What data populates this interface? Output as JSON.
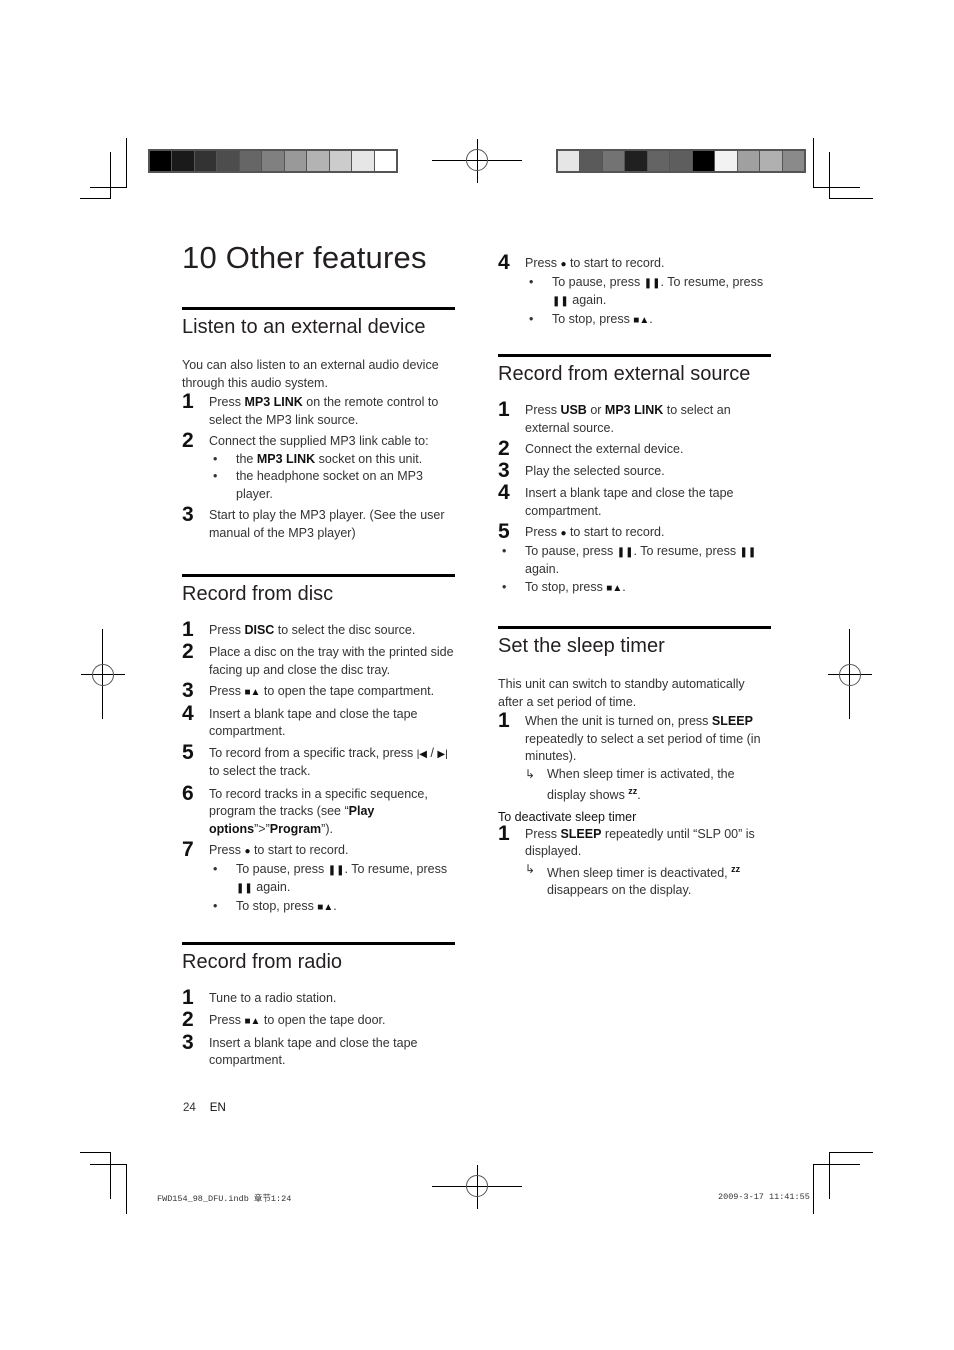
{
  "chapter": {
    "number": "10",
    "title": "10 Other features"
  },
  "color_bars": {
    "left": [
      "#000000",
      "#1a1a1a",
      "#333333",
      "#4d4d4d",
      "#666666",
      "#808080",
      "#999999",
      "#b3b3b3",
      "#cccccc",
      "#e6e6e6",
      "#ffffff"
    ],
    "right": [
      "#e6e6e6",
      "#5a5a5a",
      "#737373",
      "#202020",
      "#646464",
      "#5e5e5e",
      "#000000",
      "#f2f2f2",
      "#a0a0a0",
      "#b0b0b0",
      "#8a8a8a"
    ]
  },
  "sections": {
    "listen_external": {
      "title": "Listen to an external device",
      "intro": "You can also listen to an external audio device through this audio system.",
      "steps": [
        {
          "num": "1",
          "pre": "Press ",
          "bold": "MP3 LINK",
          "post": " on the remote control to select the MP3 link source."
        },
        {
          "num": "2",
          "text": "Connect the supplied MP3 link cable to:",
          "bullets": [
            {
              "pre": "the ",
              "bold": "MP3 LINK",
              "post": " socket on this unit."
            },
            {
              "text": "the headphone socket on an MP3 player."
            }
          ]
        },
        {
          "num": "3",
          "text": "Start to play the MP3 player. (See the user manual of the MP3 player)"
        }
      ]
    },
    "record_disc": {
      "title": "Record from disc",
      "steps": [
        {
          "num": "1",
          "pre": "Press ",
          "bold": "DISC",
          "post": " to select the disc source."
        },
        {
          "num": "2",
          "text": "Place a disc on the tray with the printed side facing up and close the disc tray."
        },
        {
          "num": "3",
          "pre": "Press ",
          "icon": "■▲",
          "post": " to open the tape compartment."
        },
        {
          "num": "4",
          "text": "Insert a blank tape and close the tape compartment."
        },
        {
          "num": "5",
          "pre": "To record from a specific track, press ",
          "icon": "|◀",
          "mid": " / ",
          "icon2": "▶|",
          "post": " to select the track."
        },
        {
          "num": "6",
          "pre": "To record tracks in a specific sequence, program the tracks (see “",
          "bold": "Play options",
          "mid": "”>”",
          "bold2": "Program",
          "post": "”)."
        },
        {
          "num": "7",
          "pre": "Press ",
          "icon": "●",
          "post": " to start to record.",
          "bullets": [
            {
              "pre": "To pause, press ",
              "icon": "❚❚",
              "mid": ". To resume, press ",
              "icon2": "❚❚",
              "post": " again."
            },
            {
              "pre": "To stop, press ",
              "icon": "■▲",
              "post": "."
            }
          ]
        }
      ]
    },
    "record_radio": {
      "title": "Record from radio",
      "steps": [
        {
          "num": "1",
          "text": "Tune to a radio station."
        },
        {
          "num": "2",
          "pre": "Press ",
          "icon": "■▲",
          "post": " to open the tape door."
        },
        {
          "num": "3",
          "text": "Insert a blank tape and close the tape compartment."
        }
      ]
    },
    "record_disc_cont": {
      "steps": [
        {
          "num": "4",
          "pre": "Press ",
          "icon": "●",
          "post": " to start to record.",
          "bullets": [
            {
              "pre": "To pause, press ",
              "icon": "❚❚",
              "mid": ". To resume, press ",
              "icon2": "❚❚",
              "post": " again."
            },
            {
              "pre": "To stop, press ",
              "icon": "■▲",
              "post": "."
            }
          ]
        }
      ]
    },
    "record_external": {
      "title": "Record from external source",
      "steps": [
        {
          "num": "1",
          "pre": "Press ",
          "bold": "USB",
          "mid": " or ",
          "bold2": "MP3 LINK",
          "post": " to select an external source."
        },
        {
          "num": "2",
          "text": "Connect the external device."
        },
        {
          "num": "3",
          "text": "Play the selected source."
        },
        {
          "num": "4",
          "text": "Insert a blank tape and close the tape compartment."
        },
        {
          "num": "5",
          "pre": "Press ",
          "icon": "●",
          "post": " to start to record."
        }
      ],
      "bullets": [
        {
          "pre": "To pause, press ",
          "icon": "❚❚",
          "mid": ". To resume, press ",
          "icon2": "❚❚",
          "post": " again."
        },
        {
          "pre": "To stop, press ",
          "icon": "■▲",
          "post": "."
        }
      ]
    },
    "sleep_timer": {
      "title": "Set the sleep timer",
      "intro": "This unit can switch to standby automatically after a set period of time.",
      "steps": [
        {
          "num": "1",
          "pre": "When the unit is turned on, press ",
          "bold": "SLEEP",
          "post": " repeatedly to select a set period of time (in minutes).",
          "result": {
            "pre": "When sleep timer is activated, the display shows ",
            "icon": "zz",
            "post": "."
          }
        }
      ],
      "deactivate_heading": "To deactivate sleep timer",
      "deactivate_steps": [
        {
          "num": "1",
          "pre": "Press ",
          "bold": "SLEEP",
          "post": " repeatedly until “SLP 00” is displayed.",
          "result": {
            "pre": "When sleep timer is deactivated, ",
            "icon": "zz",
            "post": " disappears on the display."
          }
        }
      ]
    }
  },
  "footer": {
    "page_number": "24",
    "language": "EN",
    "slug_file": "FWD154_98_DFU.indb   章节1:24",
    "slug_date": "2009-3-17   11:41:55"
  },
  "icons": {
    "result_arrow": "↳",
    "bullet": "•"
  }
}
